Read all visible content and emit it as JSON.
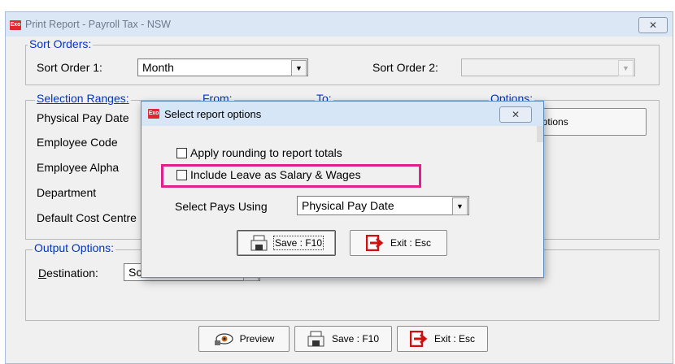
{
  "window": {
    "title": "Print Report - Payroll Tax - NSW",
    "app_icon_text": "Exo",
    "close_glyph": "✕"
  },
  "sort_orders": {
    "legend": "Sort Orders:",
    "sort1_label": "Sort Order 1:",
    "sort1_value": "Month",
    "sort2_label": "Sort Order 2:",
    "sort2_value": ""
  },
  "selection_ranges": {
    "legend": "Selection Ranges:",
    "col_from": "From:",
    "col_to": "To:",
    "col_options": "Options:",
    "rows": [
      "Physical Pay Date",
      "Employee Code",
      "Employee Alpha",
      "Department",
      "Default Cost Centre"
    ],
    "report_options_button": "Report Options"
  },
  "output_options": {
    "legend": "Output Options:",
    "destination_label": "Destination:",
    "destination_value": "Screen"
  },
  "bottom_buttons": {
    "preview": "Preview",
    "save": "Save : F10",
    "exit": "Exit : Esc"
  },
  "dialog": {
    "title": "Select report options",
    "app_icon_text": "Exo",
    "close_glyph": "✕",
    "apply_rounding_label": "Apply rounding to report totals",
    "apply_rounding_checked": false,
    "include_leave_label": "Include Leave as Salary & Wages",
    "include_leave_checked": false,
    "select_pays_label": "Select Pays Using",
    "select_pays_value": "Physical Pay Date",
    "save_button": "Save : F10",
    "exit_button": "Exit : Esc",
    "highlight_color": "#e0218a"
  }
}
